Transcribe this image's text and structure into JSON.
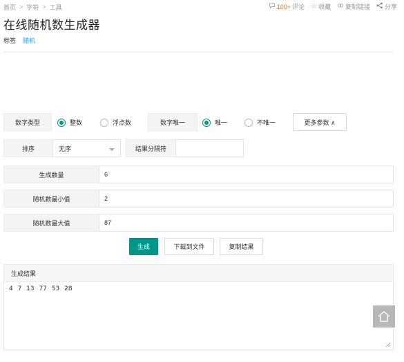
{
  "breadcrumb": {
    "items": [
      "首页",
      "字符",
      "工具"
    ],
    "separator": ">"
  },
  "actions": {
    "comment_count": "100+",
    "comment_label": "评论",
    "favorite_label": "收藏",
    "copy_link_label": "复制链接",
    "share_label": "分享"
  },
  "page": {
    "title": "在线随机数生成器",
    "tags_label": "标签",
    "tag": "随机"
  },
  "form": {
    "number_type": {
      "label": "数字类型",
      "options": [
        "整数",
        "浮点数"
      ],
      "selected": "整数"
    },
    "unique": {
      "label": "数字唯一",
      "options": [
        "唯一",
        "不唯一"
      ],
      "selected": "唯一"
    },
    "more_params": "更多参数 ∧",
    "sort": {
      "label": "排序",
      "value": "无序"
    },
    "separator": {
      "label": "结果分隔符",
      "value": ""
    },
    "count": {
      "label": "生成数量",
      "value": "6"
    },
    "min": {
      "label": "随机数最小值",
      "value": "2"
    },
    "max": {
      "label": "随机数最大值",
      "value": "87"
    }
  },
  "buttons": {
    "generate": "生成",
    "download": "下载到文件",
    "copy": "复制结果"
  },
  "result": {
    "label": "生成结果",
    "value": "4  7  13  77  53  28"
  },
  "colors": {
    "accent": "#009688",
    "link": "#1e9fff",
    "highlight": "#ff6a1a"
  },
  "icons": {
    "comment": "comment-icon",
    "favorite": "star-icon",
    "copy_link": "link-icon",
    "share": "share-icon",
    "back_to_top": "home-outline-icon"
  }
}
